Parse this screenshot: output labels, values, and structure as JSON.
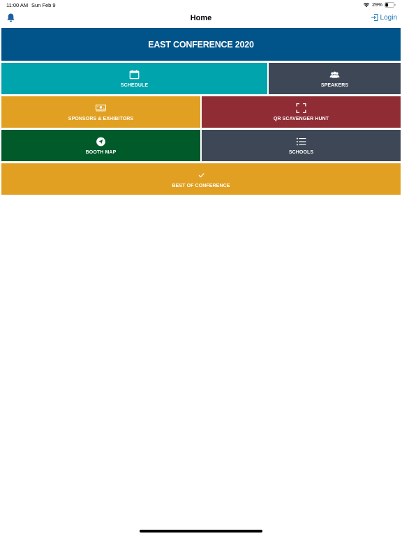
{
  "status_bar": {
    "time": "11:00 AM",
    "date": "Sun Feb 9",
    "battery": "29%"
  },
  "nav": {
    "title": "Home",
    "login_label": "Login"
  },
  "banner": {
    "title": "EAST CONFERENCE 2020",
    "color": "#00548a"
  },
  "tiles": [
    {
      "label": "SCHEDULE",
      "icon": "calendar-icon",
      "color": "#00a4ad"
    },
    {
      "label": "SPEAKERS",
      "icon": "people-icon",
      "color": "#3d4756"
    },
    {
      "label": "SPONSORS & EXHIBITORS",
      "icon": "money-icon",
      "color": "#e1a021"
    },
    {
      "label": "QR SCAVENGER HUNT",
      "icon": "qr-scan-icon",
      "color": "#8f2c34"
    },
    {
      "label": "BOOTH MAP",
      "icon": "navigation-icon",
      "color": "#005a2a"
    },
    {
      "label": "SCHOOLS",
      "icon": "list-icon",
      "color": "#3d4756"
    },
    {
      "label": "BEST OF CONFERENCE",
      "icon": "checkmark-icon",
      "color": "#e1a021"
    }
  ],
  "colors": {
    "accent": "#1e78b4",
    "bell": "#1e5fa0"
  }
}
